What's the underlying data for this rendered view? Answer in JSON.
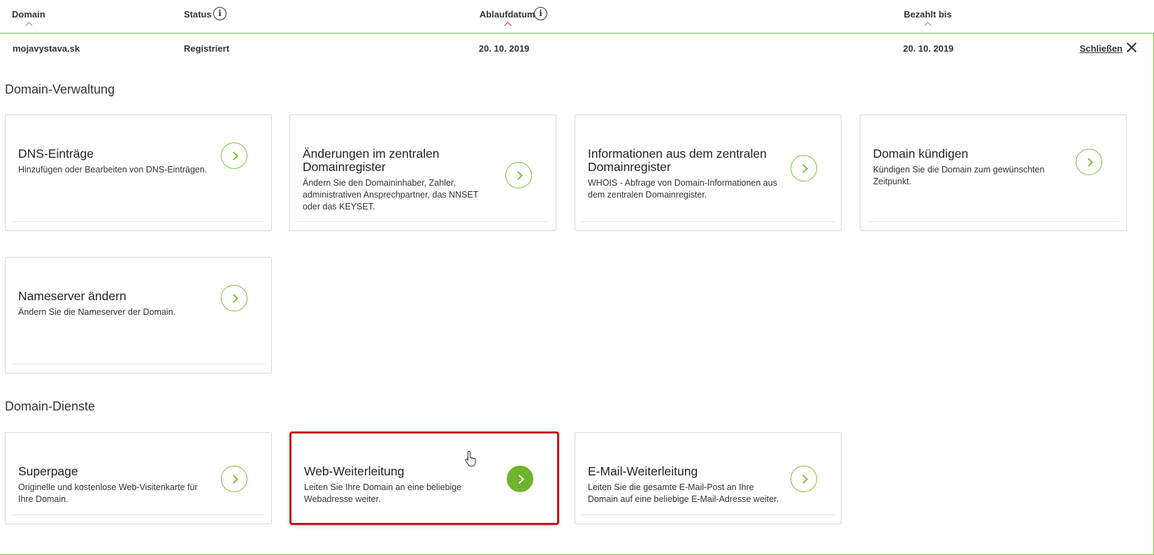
{
  "table": {
    "headers": {
      "domain": "Domain",
      "status": "Status",
      "expiry": "Ablaufdatum",
      "paid_until": "Bezahlt bis"
    },
    "row": {
      "domain": "mojavystava.sk",
      "status": "Registriert",
      "expiry": "20. 10. 2019",
      "paid_until": "20. 10. 2019",
      "close_label": "Schließen"
    }
  },
  "sections": {
    "management": {
      "title": "Domain-Verwaltung",
      "cards": [
        {
          "title": "DNS-Einträge",
          "desc": "Hinzufügen oder Bearbeiten von DNS-Einträgen."
        },
        {
          "title": "Änderungen im zentralen Domainregister",
          "desc": "Ändern Sie den Domaininhaber, Zahler, administrativen Ansprechpartner, das NNSET oder das KEYSET."
        },
        {
          "title": "Informationen aus dem zentralen Domainregister",
          "desc": "WHOIS - Abfrage von Domain-Informationen aus dem zentralen Domainregister."
        },
        {
          "title": "Domain kündigen",
          "desc": "Kündigen Sie die Domain zum gewünschten Zeitpunkt."
        },
        {
          "title": "Nameserver ändern",
          "desc": "Ändern Sie die Nameserver der Domain."
        }
      ]
    },
    "services": {
      "title": "Domain-Dienste",
      "cards": [
        {
          "title": "Superpage",
          "desc": "Originelle und kostenlose Web-Visitenkarte für Ihre Domain."
        },
        {
          "title": "Web-Weiterleitung",
          "desc": "Leiten Sie Ihre Domain an eine beliebige Webadresse weiter."
        },
        {
          "title": "E-Mail-Weiterleitung",
          "desc": "Leiten Sie die gesamte E-Mail-Post an Ihre Domain auf eine beliebige E-Mail-Adresse weiter."
        }
      ]
    }
  },
  "colors": {
    "accent": "#7cbf2f",
    "highlight": "#c0151b",
    "sort_active": "#d9262c"
  },
  "icons": {
    "info": "info-circle-icon",
    "close": "close-icon",
    "arrow": "chevron-right-icon",
    "cursor": "hand-pointer-icon"
  }
}
